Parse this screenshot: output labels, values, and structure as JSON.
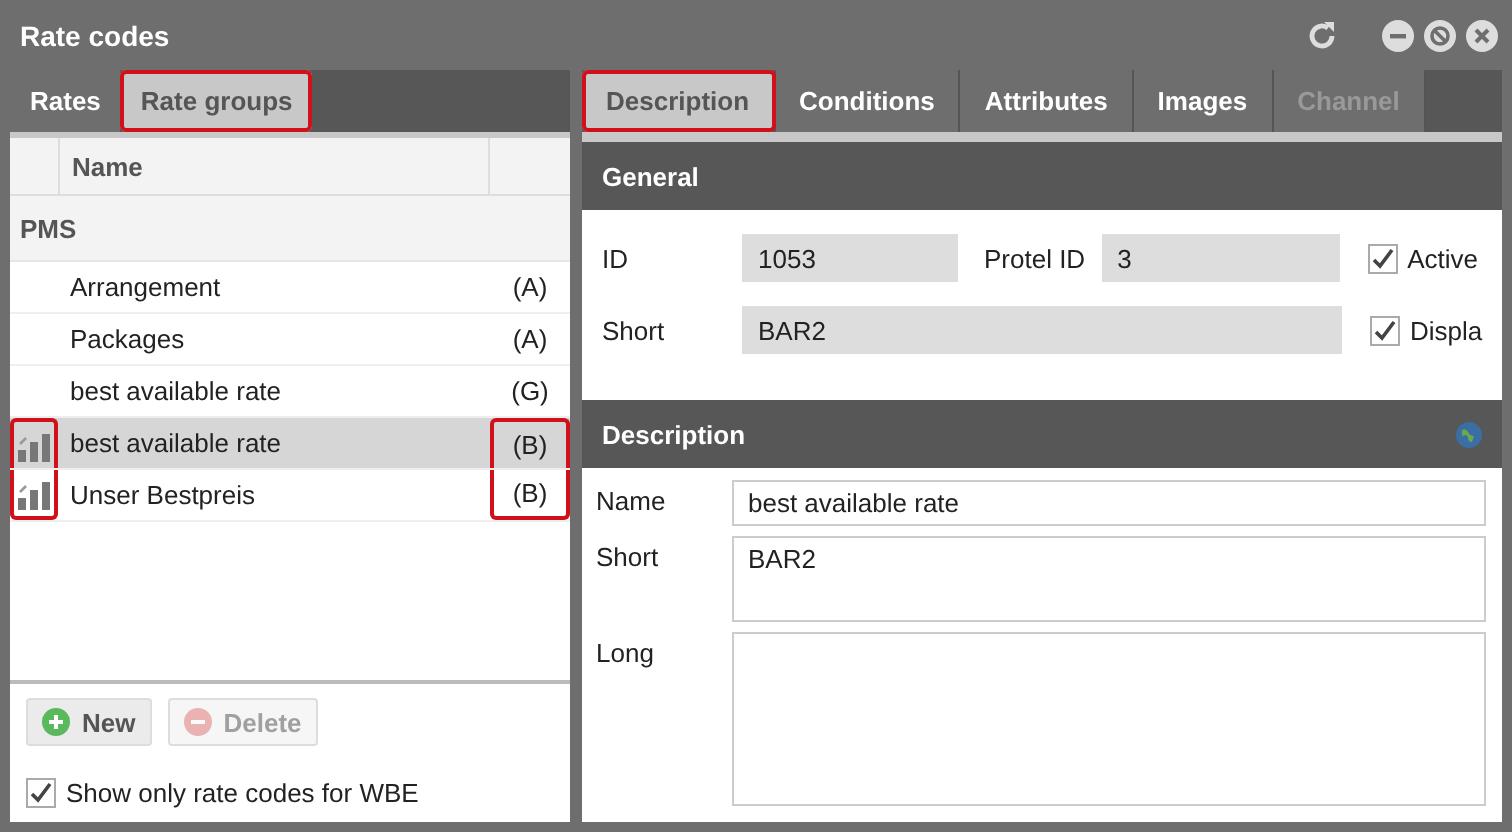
{
  "window": {
    "title": "Rate codes"
  },
  "left_tabs": [
    {
      "label": "Rates",
      "selected": false,
      "highlighted": false
    },
    {
      "label": "Rate groups",
      "selected": true,
      "highlighted": true
    }
  ],
  "list": {
    "columns": [
      "Name"
    ],
    "group": "PMS",
    "rows": [
      {
        "name": "Arrangement",
        "code": "(A)",
        "has_icon": false,
        "selected": false,
        "highlighted": false
      },
      {
        "name": "Packages",
        "code": "(A)",
        "has_icon": false,
        "selected": false,
        "highlighted": false
      },
      {
        "name": "best available rate",
        "code": "(G)",
        "has_icon": false,
        "selected": false,
        "highlighted": false
      },
      {
        "name": "best available rate",
        "code": "(B)",
        "has_icon": true,
        "selected": true,
        "highlighted": true
      },
      {
        "name": "Unser Bestpreis",
        "code": "(B)",
        "has_icon": true,
        "selected": false,
        "highlighted": true
      }
    ]
  },
  "buttons": [
    {
      "label": "New",
      "kind": "add",
      "disabled": false
    },
    {
      "label": "Delete",
      "kind": "delete",
      "disabled": true
    }
  ],
  "filter": {
    "label": "Show only rate codes for WBE",
    "checked": true
  },
  "right_tabs": [
    {
      "label": "Description",
      "selected": true,
      "disabled": false,
      "highlighted": true
    },
    {
      "label": "Conditions",
      "selected": false,
      "disabled": false,
      "highlighted": false
    },
    {
      "label": "Attributes",
      "selected": false,
      "disabled": false,
      "highlighted": false
    },
    {
      "label": "Images",
      "selected": false,
      "disabled": false,
      "highlighted": false
    },
    {
      "label": "Channel",
      "selected": false,
      "disabled": true,
      "highlighted": false
    }
  ],
  "general": {
    "title": "General",
    "id_label": "ID",
    "id_value": "1053",
    "protel_label": "Protel ID",
    "protel_value": "3",
    "short_label": "Short",
    "short_value": "BAR2",
    "active": {
      "label": "Active",
      "checked": true
    },
    "display": {
      "label": "Displa",
      "checked": true
    }
  },
  "description": {
    "title": "Description",
    "name_label": "Name",
    "name_value": "best available rate",
    "short_label": "Short",
    "short_value": "BAR2",
    "long_label": "Long"
  }
}
